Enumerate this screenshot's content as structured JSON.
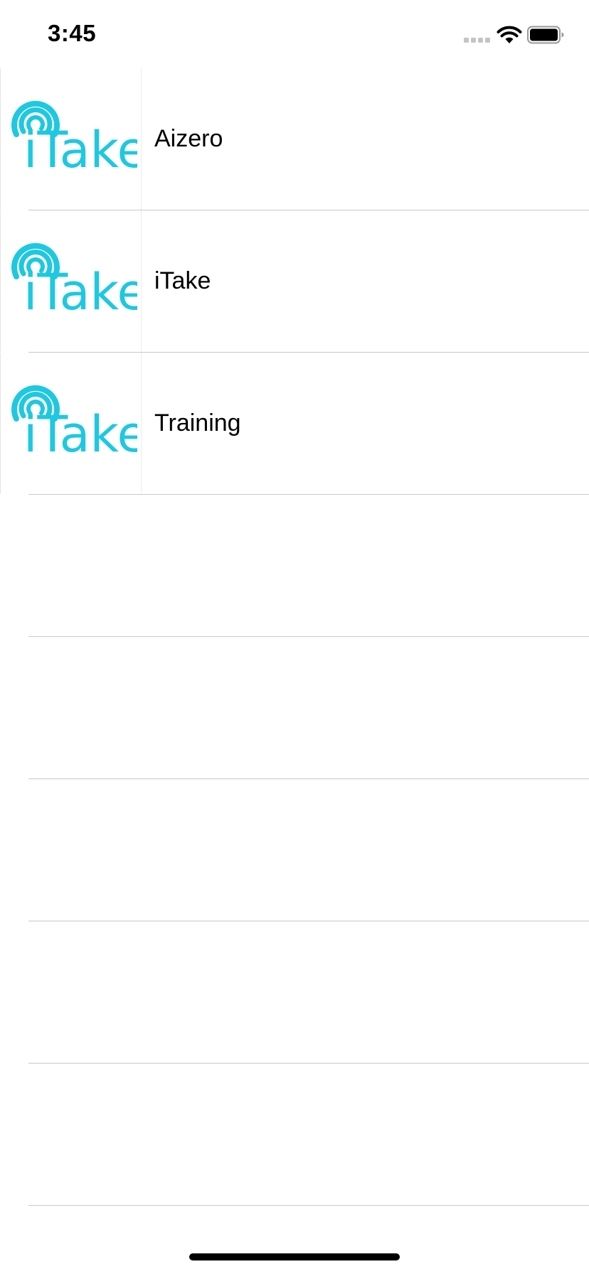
{
  "status_bar": {
    "time": "3:45",
    "icons": [
      "cellular-signal-icon",
      "wifi-icon",
      "battery-icon"
    ]
  },
  "list": {
    "items": [
      {
        "label": "Aizero",
        "thumbnail_text": "iTake",
        "thumbnail_icon": "itake-logo-icon"
      },
      {
        "label": "iTake",
        "thumbnail_text": "iTake",
        "thumbnail_icon": "itake-logo-icon"
      },
      {
        "label": "Training",
        "thumbnail_text": "iTake",
        "thumbnail_icon": "itake-logo-icon"
      }
    ]
  },
  "colors": {
    "logo": "#1ec8e0",
    "separator": "#c8c7cc",
    "text": "#000000",
    "background": "#ffffff"
  }
}
